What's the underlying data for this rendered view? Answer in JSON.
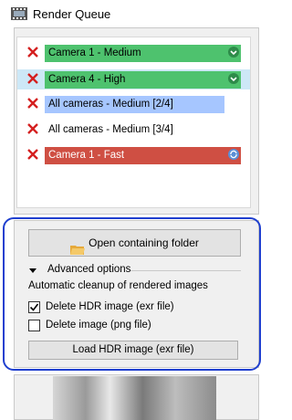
{
  "window": {
    "title": "Render Queue",
    "icon": "film-strip-icon"
  },
  "queue": [
    {
      "label": "Camera 1 - Medium",
      "color": "#4ec26e",
      "status": "chevron-down-icon"
    },
    {
      "label": "Camera 4 - High",
      "color": "#4ec26e",
      "status": "chevron-down-icon",
      "selected": true
    },
    {
      "label": "All cameras - Medium [2/4]",
      "color": "#a6c6ff",
      "progress": 1.0
    },
    {
      "label": "All cameras - Medium [3/4]",
      "color": "#ffffff"
    },
    {
      "label": "Camera 1 - Fast",
      "color": "#cf4f43",
      "status": "refresh-icon"
    }
  ],
  "options": {
    "open_folder_label": "Open containing folder",
    "advanced_label": "Advanced options",
    "cleanup_text": "Automatic cleanup of rendered images",
    "delete_hdr_label": "Delete HDR image (exr file)",
    "delete_hdr_checked": true,
    "delete_png_label": "Delete image (png file)",
    "delete_png_checked": false,
    "load_hdr_label": "Load HDR image (exr file)"
  },
  "colors": {
    "highlight": "#1f3fcf",
    "delete_icon": "#d42020"
  }
}
